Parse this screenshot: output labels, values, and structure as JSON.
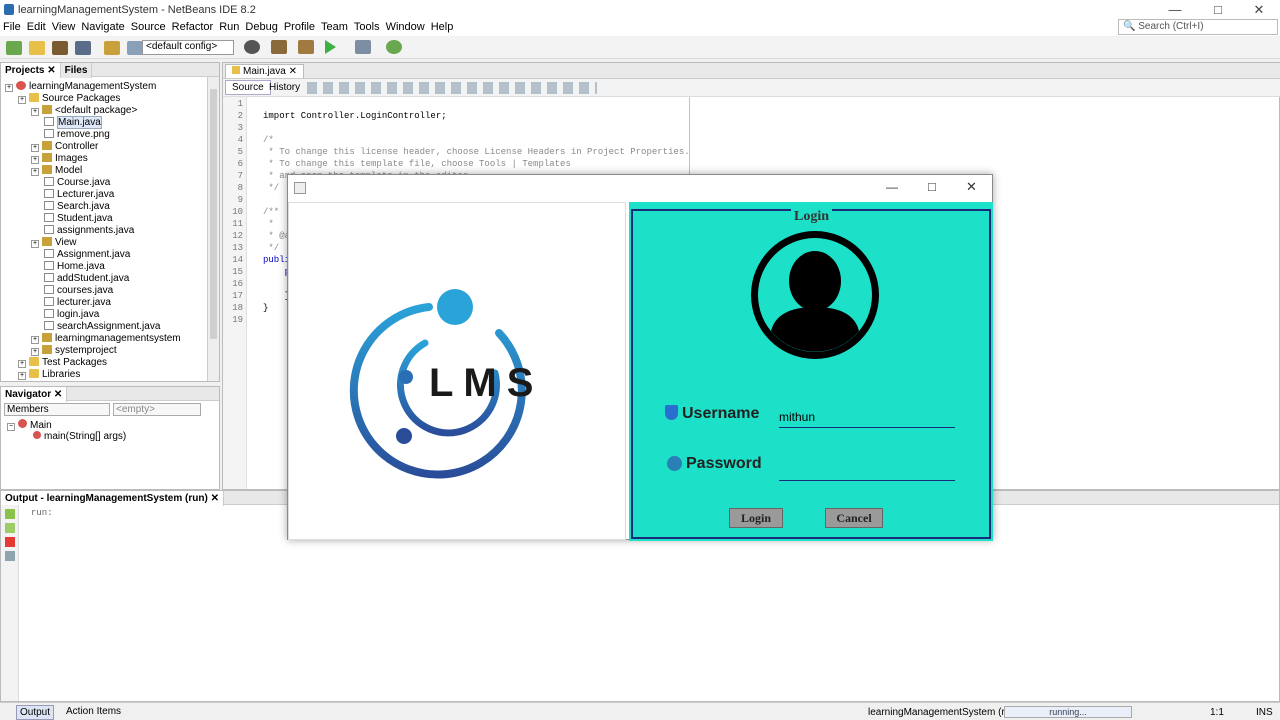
{
  "window": {
    "title": "learningManagementSystem - NetBeans IDE 8.2",
    "minimize": "—",
    "maximize": "□",
    "close": "✕"
  },
  "menu": [
    "File",
    "Edit",
    "View",
    "Navigate",
    "Source",
    "Refactor",
    "Run",
    "Debug",
    "Profile",
    "Team",
    "Tools",
    "Window",
    "Help"
  ],
  "search": {
    "placeholder": "Search (Ctrl+I)"
  },
  "toolbar": {
    "config": "<default config>"
  },
  "projects": {
    "tabs": [
      "Projects",
      "Files"
    ],
    "tree": [
      {
        "label": "learningManagementSystem",
        "depth": 0,
        "kind": "proj"
      },
      {
        "label": "Source Packages",
        "depth": 1,
        "kind": "folder"
      },
      {
        "label": "<default package>",
        "depth": 2,
        "kind": "pkg"
      },
      {
        "label": "Main.java",
        "depth": 3,
        "kind": "file"
      },
      {
        "label": "remove.png",
        "depth": 3,
        "kind": "file"
      },
      {
        "label": "Controller",
        "depth": 2,
        "kind": "pkg"
      },
      {
        "label": "Images",
        "depth": 2,
        "kind": "pkg"
      },
      {
        "label": "Model",
        "depth": 2,
        "kind": "pkg"
      },
      {
        "label": "Course.java",
        "depth": 3,
        "kind": "file"
      },
      {
        "label": "Lecturer.java",
        "depth": 3,
        "kind": "file"
      },
      {
        "label": "Search.java",
        "depth": 3,
        "kind": "file"
      },
      {
        "label": "Student.java",
        "depth": 3,
        "kind": "file"
      },
      {
        "label": "assignments.java",
        "depth": 3,
        "kind": "file"
      },
      {
        "label": "View",
        "depth": 2,
        "kind": "pkg"
      },
      {
        "label": "Assignment.java",
        "depth": 3,
        "kind": "file"
      },
      {
        "label": "Home.java",
        "depth": 3,
        "kind": "file"
      },
      {
        "label": "addStudent.java",
        "depth": 3,
        "kind": "file"
      },
      {
        "label": "courses.java",
        "depth": 3,
        "kind": "file"
      },
      {
        "label": "lecturer.java",
        "depth": 3,
        "kind": "file"
      },
      {
        "label": "login.java",
        "depth": 3,
        "kind": "file"
      },
      {
        "label": "searchAssignment.java",
        "depth": 3,
        "kind": "file"
      },
      {
        "label": "learningmanagementsystem",
        "depth": 2,
        "kind": "pkg"
      },
      {
        "label": "systemproject",
        "depth": 2,
        "kind": "pkg"
      },
      {
        "label": "Test Packages",
        "depth": 1,
        "kind": "folder"
      },
      {
        "label": "Libraries",
        "depth": 1,
        "kind": "folder"
      }
    ]
  },
  "navigator": {
    "title": "Navigator",
    "members": "Members",
    "empty": "<empty>",
    "root": "Main",
    "method": "main(String[] args)"
  },
  "editor": {
    "tab": "Main.java",
    "source_tab": "Source",
    "history_tab": "History",
    "lines": [
      {
        "n": "1",
        "text": "",
        "cls": ""
      },
      {
        "n": "2",
        "text": "import Controller.LoginController;",
        "cls": ""
      },
      {
        "n": "3",
        "text": "",
        "cls": ""
      },
      {
        "n": "4",
        "text": "/*",
        "cls": "comment"
      },
      {
        "n": "5",
        "text": " * To change this license header, choose License Headers in Project Properties.",
        "cls": "comment"
      },
      {
        "n": "6",
        "text": " * To change this template file, choose Tools | Templates",
        "cls": "comment"
      },
      {
        "n": "7",
        "text": " * and open the template in the editor.",
        "cls": "comment"
      },
      {
        "n": "8",
        "text": " */",
        "cls": "comment"
      },
      {
        "n": "9",
        "text": "",
        "cls": ""
      },
      {
        "n": "10",
        "text": "/**",
        "cls": "comment"
      },
      {
        "n": "11",
        "text": " *",
        "cls": "comment"
      },
      {
        "n": "12",
        "text": " * @a",
        "cls": "comment"
      },
      {
        "n": "13",
        "text": " */",
        "cls": "comment"
      },
      {
        "n": "14",
        "text": "publi",
        "cls": "kw"
      },
      {
        "n": "15",
        "text": "    p",
        "cls": "kw"
      },
      {
        "n": "16",
        "text": "",
        "cls": ""
      },
      {
        "n": "17",
        "text": "    }",
        "cls": ""
      },
      {
        "n": "18",
        "text": "}",
        "cls": ""
      },
      {
        "n": "19",
        "text": "",
        "cls": ""
      }
    ]
  },
  "output": {
    "title": "Output - learningManagementSystem (run)",
    "text": "run:"
  },
  "status": {
    "output_tab": "Output",
    "action_items": "Action Items",
    "project": "learningManagementSystem (run)",
    "progress": "running...",
    "position": "1:1",
    "mode": "INS"
  },
  "dialog": {
    "minimize": "—",
    "maximize": "□",
    "close": "✕",
    "logo_text": "LMS",
    "legend": "Login",
    "username_label": "Username",
    "username_value": "mithun",
    "password_label": "Password",
    "login_button": "Login",
    "cancel_button": "Cancel",
    "colors": {
      "panel": "#1de0c9",
      "frame": "#1a2a7a",
      "logo_blue": "#1e6fb5"
    }
  }
}
